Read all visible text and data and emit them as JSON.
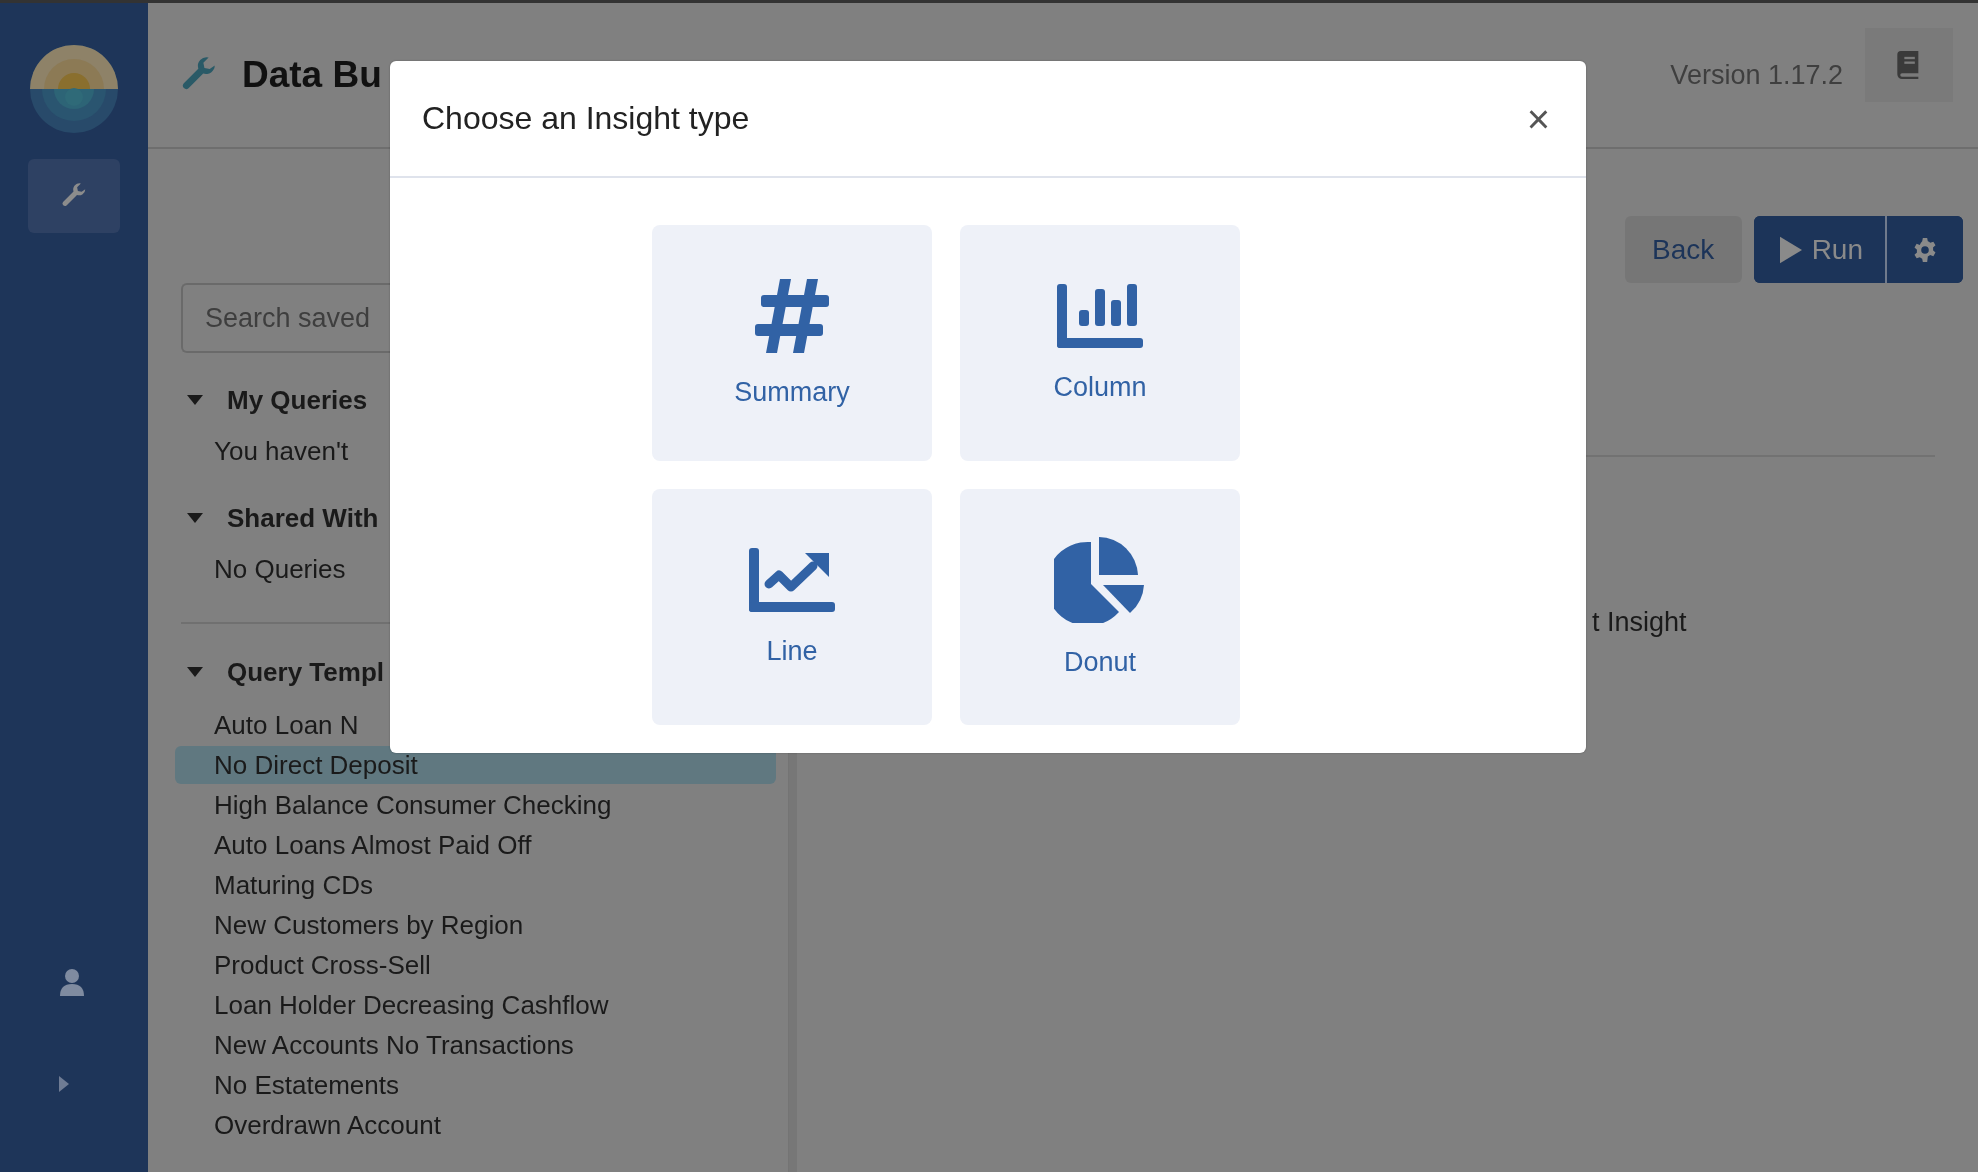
{
  "sidebar": {
    "nav_items": [
      {
        "selected": true
      }
    ]
  },
  "header": {
    "title": "Data Bu",
    "version": "Version 1.17.2"
  },
  "toolbar": {
    "buttons": [
      {
        "label": "Back",
        "kind": "secondary"
      },
      {
        "label": "Run",
        "kind": "primary"
      }
    ]
  },
  "search": {
    "placeholder": "Search saved"
  },
  "sections": [
    {
      "title": "My Queries",
      "expanded": true,
      "items": [
        {
          "label": "You haven't",
          "kind": "note",
          "selected": false
        }
      ]
    },
    {
      "title": "Shared With",
      "expanded": true,
      "items": [
        {
          "label": "No Queries",
          "kind": "note",
          "selected": false
        }
      ]
    },
    {
      "title": "Query Templ",
      "expanded": true,
      "items": [
        {
          "label": "Auto Loan N",
          "kind": "link",
          "selected": false
        },
        {
          "label": "No Direct Deposit",
          "kind": "link",
          "selected": true
        },
        {
          "label": "High Balance Consumer Checking",
          "kind": "link",
          "selected": false
        },
        {
          "label": "Auto Loans Almost Paid Off",
          "kind": "link",
          "selected": false
        },
        {
          "label": "Maturing CDs",
          "kind": "link",
          "selected": false
        },
        {
          "label": "New Customers by Region",
          "kind": "link",
          "selected": false
        },
        {
          "label": "Product Cross-Sell",
          "kind": "link",
          "selected": false
        },
        {
          "label": "Loan Holder Decreasing Cashflow",
          "kind": "link",
          "selected": false
        },
        {
          "label": "New Accounts No Transactions",
          "kind": "link",
          "selected": false
        },
        {
          "label": "No Estatements",
          "kind": "link",
          "selected": false
        },
        {
          "label": "Overdrawn Account",
          "kind": "link",
          "selected": false
        }
      ]
    }
  ],
  "main": {
    "text": "t Insight"
  },
  "modal": {
    "title": "Choose an Insight type",
    "close": "×",
    "options": [
      {
        "label": "Summary",
        "kind": "summary"
      },
      {
        "label": "Column",
        "kind": "column"
      },
      {
        "label": "Line",
        "kind": "line"
      },
      {
        "label": "Donut",
        "kind": "donut"
      }
    ]
  }
}
